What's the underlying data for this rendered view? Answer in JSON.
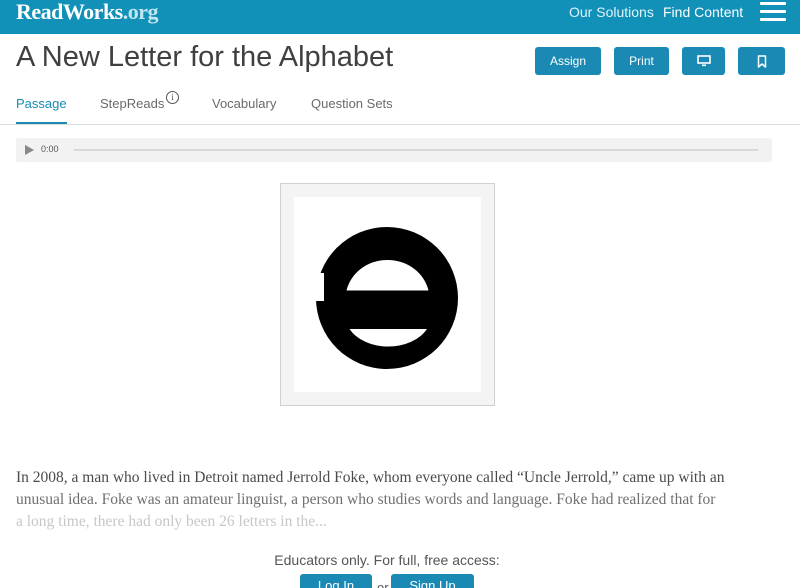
{
  "header": {
    "logo_main": "ReadWorks",
    "logo_suffix": ".org",
    "nav": {
      "solutions": "Our Solutions",
      "find_content": "Find Content"
    },
    "menu_icon": "hamburger-menu-icon",
    "background_color": "#1190b8"
  },
  "article": {
    "title": "A New Letter for the Alphabet"
  },
  "actions": {
    "assign": "Assign",
    "print": "Print",
    "present_icon": "monitor-icon",
    "bookmark_icon": "bookmark-icon",
    "button_color": "#1a8ab4"
  },
  "tabs": [
    {
      "label": "Passage",
      "active": true
    },
    {
      "label": "StepReads"
    },
    {
      "label": "Vocabulary"
    },
    {
      "label": "Question Sets"
    }
  ],
  "stepreads_info_glyph": "i",
  "audio": {
    "time": "0:00",
    "play_icon": "play-icon",
    "progress": 0
  },
  "figure": {
    "glyph": "schwa-letter-image"
  },
  "passage": {
    "line1": "In 2008, a man who lived in Detroit named Jerrold Foke, whom everyone called “Uncle Jerrold,” came up with an",
    "line2": "unusual idea. Foke was an amateur linguist, a person who studies words and language. Foke had realized that for",
    "line3": "a long time, there had only been 26 letters in the..."
  },
  "access": {
    "message": "Educators only. For full, free access:",
    "login": "Log In",
    "or": "or",
    "signup": "Sign Up"
  }
}
